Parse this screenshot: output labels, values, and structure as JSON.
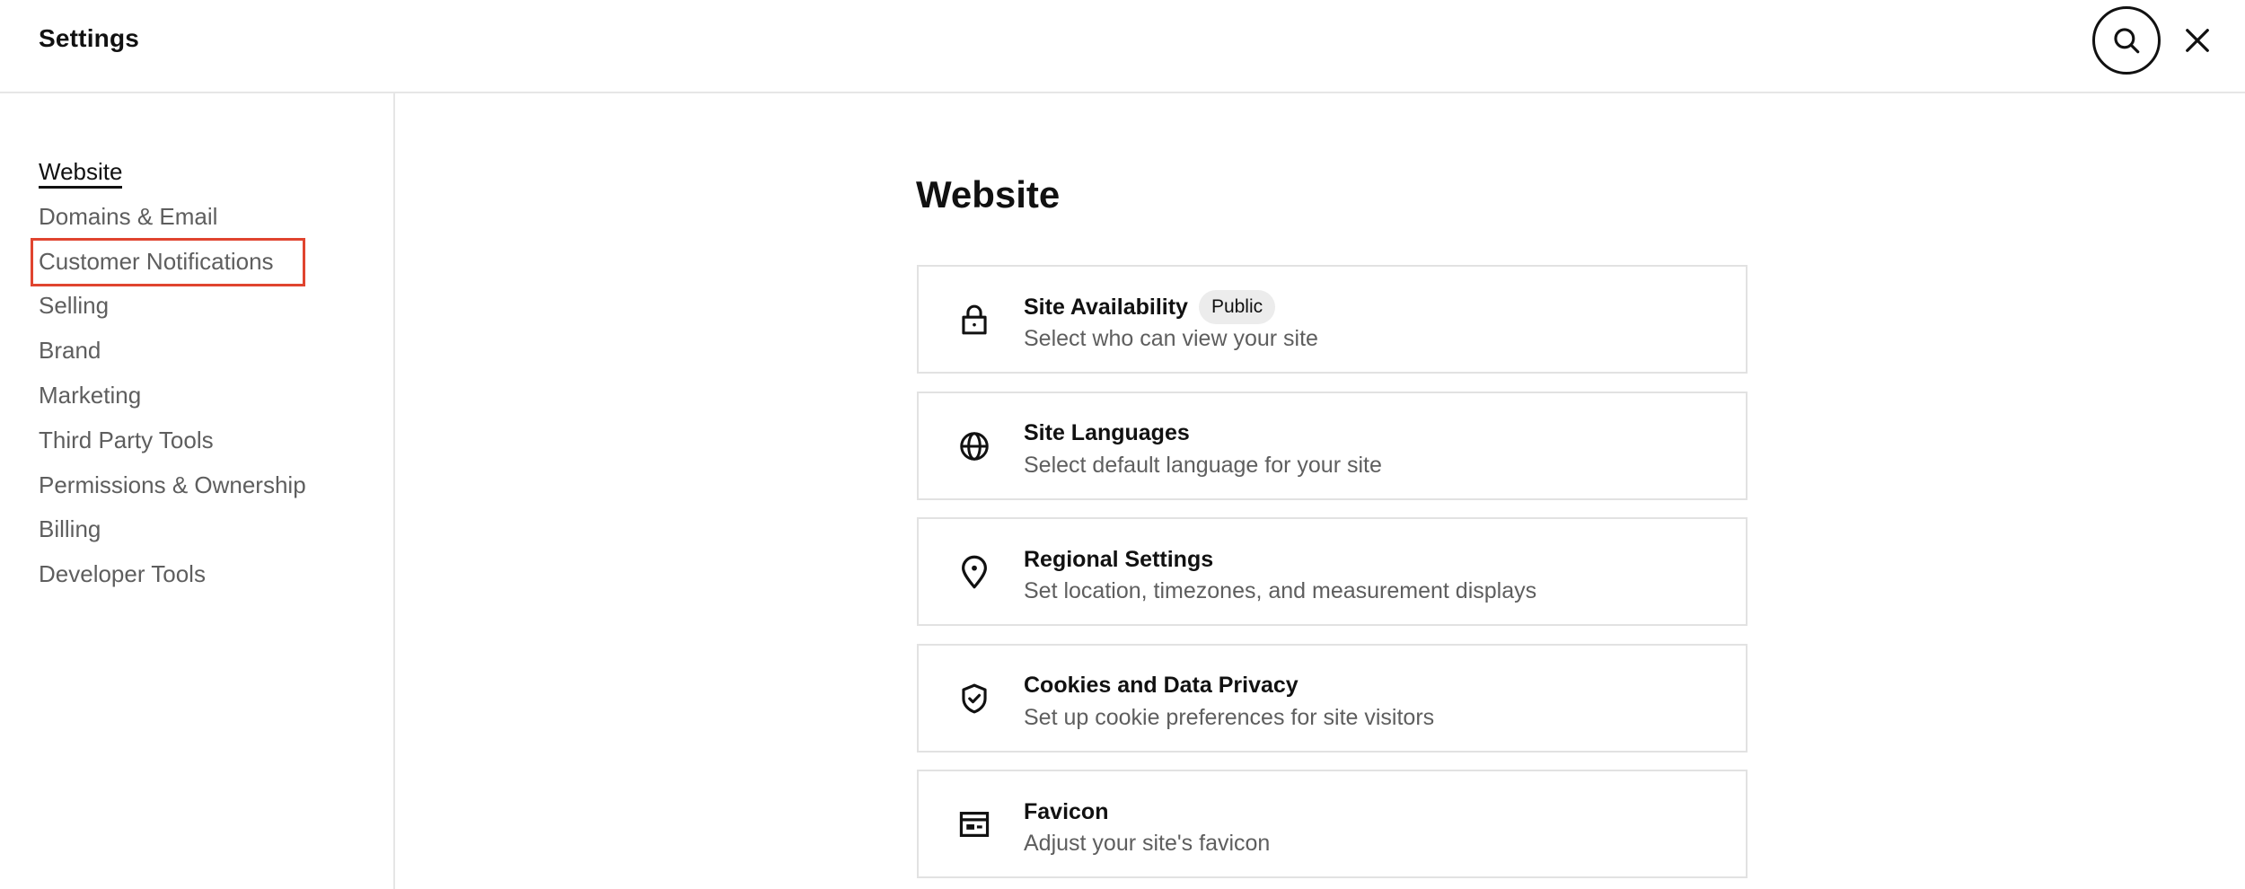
{
  "header": {
    "title": "Settings"
  },
  "sidebar": {
    "items": [
      {
        "label": "Website"
      },
      {
        "label": "Domains & Email"
      },
      {
        "label": "Customer Notifications"
      },
      {
        "label": "Selling"
      },
      {
        "label": "Brand"
      },
      {
        "label": "Marketing"
      },
      {
        "label": "Third Party Tools"
      },
      {
        "label": "Permissions & Ownership"
      },
      {
        "label": "Billing"
      },
      {
        "label": "Developer Tools"
      }
    ],
    "active_item": "Website",
    "highlighted_item": "Customer Notifications",
    "highlight_color": "#e0442f"
  },
  "main": {
    "heading": "Website",
    "cards": [
      {
        "title": "Site Availability",
        "badge": "Public",
        "description": "Select who can view your site",
        "icon": "lock-icon"
      },
      {
        "title": "Site Languages",
        "description": "Select default language for your site",
        "icon": "globe-icon"
      },
      {
        "title": "Regional Settings",
        "description": "Set location, timezones, and measurement displays",
        "icon": "location-pin-icon"
      },
      {
        "title": "Cookies and Data Privacy",
        "description": "Set up cookie preferences for site visitors",
        "icon": "shield-check-icon"
      },
      {
        "title": "Favicon",
        "description": "Adjust your site's favicon",
        "icon": "favicon-icon"
      }
    ]
  }
}
